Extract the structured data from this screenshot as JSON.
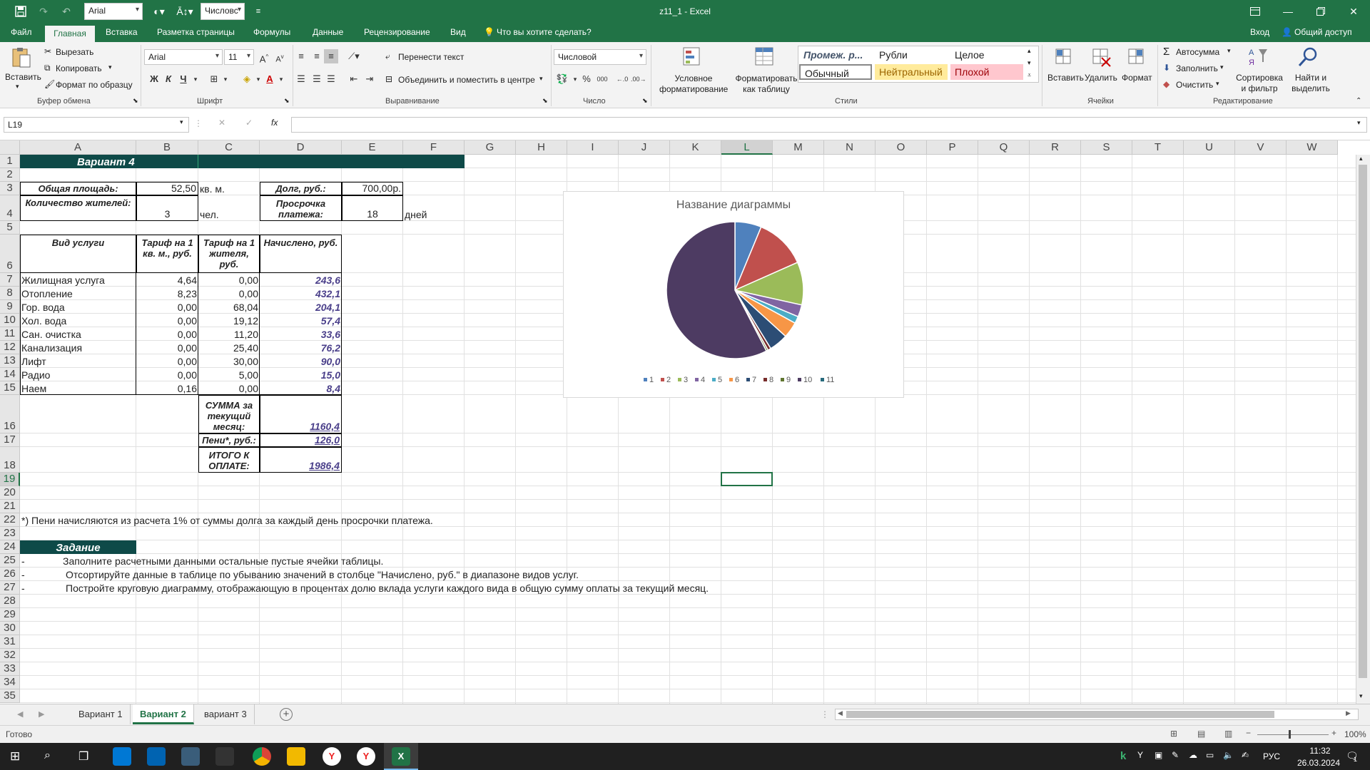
{
  "title_bar": {
    "doc_title": "z11_1 - Excel",
    "font_name": "Arial",
    "number_format": "Числовс"
  },
  "menu": {
    "items": [
      "Файл",
      "Главная",
      "Вставка",
      "Разметка страницы",
      "Формулы",
      "Данные",
      "Рецензирование",
      "Вид"
    ],
    "tell_me": "Что вы хотите сделать?",
    "sign_in": "Вход",
    "share": "Общий доступ"
  },
  "ribbon": {
    "clipboard": {
      "paste": "Вставить",
      "cut": "Вырезать",
      "copy": "Копировать",
      "format_painter": "Формат по образцу",
      "group": "Буфер обмена"
    },
    "font": {
      "name": "Arial",
      "size": "11",
      "bold": "Ж",
      "italic": "К",
      "underline": "Ч",
      "group": "Шрифт"
    },
    "alignment": {
      "wrap": "Перенести текст",
      "merge": "Объединить и поместить в центре",
      "group": "Выравнивание"
    },
    "number": {
      "format": "Числовой",
      "group": "Число"
    },
    "styles": {
      "conditional": "Условное форматирование",
      "format_table": "Форматировать как таблицу",
      "cells": [
        "Промеж. р...",
        "Рубли",
        "Целое",
        "Обычный",
        "Нейтральный",
        "Плохой"
      ],
      "group": "Стили"
    },
    "cells_group": {
      "insert": "Вставить",
      "delete": "Удалить",
      "format": "Формат",
      "group": "Ячейки"
    },
    "editing": {
      "autosum": "Автосумма",
      "fill": "Заполнить",
      "clear": "Очистить",
      "sort": "Сортировка и фильтр",
      "find": "Найти и выделить",
      "group": "Редактирование"
    }
  },
  "formula_bar": {
    "name_box": "L19",
    "fx": "fx"
  },
  "columns": [
    "A",
    "B",
    "C",
    "D",
    "E",
    "F",
    "G",
    "H",
    "I",
    "J",
    "K",
    "L",
    "M",
    "N",
    "O",
    "P",
    "Q",
    "R",
    "S",
    "T",
    "U",
    "V",
    "W"
  ],
  "rows": [
    "1",
    "2",
    "3",
    "4",
    "5",
    "6",
    "7",
    "8",
    "9",
    "10",
    "11",
    "12",
    "13",
    "14",
    "15",
    "16",
    "17",
    "18",
    "19",
    "20",
    "21",
    "22",
    "23",
    "24",
    "25",
    "26",
    "27",
    "28",
    "29",
    "30",
    "31",
    "32",
    "33",
    "34",
    "35"
  ],
  "sheet": {
    "variant_title": "Вариант 4",
    "area_label": "Общая площадь:",
    "area_value": "52,50",
    "area_unit": "кв. м.",
    "residents_label": "Количество жителей:",
    "residents_value": "3",
    "residents_unit": "чел.",
    "debt_label": "Долг, руб.:",
    "debt_value": "700,00р.",
    "overdue_label": "Просрочка платежа:",
    "overdue_value": "18",
    "overdue_unit": "дней",
    "headers": [
      "Вид услуги",
      "Тариф на 1 кв. м., руб.",
      "Тариф на 1 жителя, руб.",
      "Начислено, руб."
    ],
    "services": [
      {
        "name": "Жилищная услуга",
        "t_area": "4,64",
        "t_res": "0,00",
        "charged": "243,6"
      },
      {
        "name": "Отопление",
        "t_area": "8,23",
        "t_res": "0,00",
        "charged": "432,1"
      },
      {
        "name": "Гор. вода",
        "t_area": "0,00",
        "t_res": "68,04",
        "charged": "204,1"
      },
      {
        "name": "Хол. вода",
        "t_area": "0,00",
        "t_res": "19,12",
        "charged": "57,4"
      },
      {
        "name": "Сан. очистка",
        "t_area": "0,00",
        "t_res": "11,20",
        "charged": "33,6"
      },
      {
        "name": "Канализация",
        "t_area": "0,00",
        "t_res": "25,40",
        "charged": "76,2"
      },
      {
        "name": "Лифт",
        "t_area": "0,00",
        "t_res": "30,00",
        "charged": "90,0"
      },
      {
        "name": "Радио",
        "t_area": "0,00",
        "t_res": "5,00",
        "charged": "15,0"
      },
      {
        "name": "Наем",
        "t_area": "0,16",
        "t_res": "0,00",
        "charged": "8,4"
      }
    ],
    "sum_label": "СУММА за текущий месяц:",
    "sum_value": "1160,4",
    "penalty_label": "Пени*, руб.:",
    "penalty_value": "126,0",
    "total_label": "ИТОГО К ОПЛАТЕ:",
    "total_value": "1986,4",
    "footnote": "*) Пени начисляются из расчета 1% от суммы долга за каждый день просрочки платежа.",
    "task_title": "Задание",
    "task_dash": "-",
    "tasks": [
      "Заполните расчетными данными остальные пустые ячейки таблицы.",
      "Отсортируйте данные в таблице по убыванию значений в столбце \"Начислено, руб.\" в диапазоне видов услуг.",
      "Постройте круговую диаграмму, отображающую в процентах долю вклада услуги каждого вида в общую сумму оплаты за текущий месяц."
    ]
  },
  "chart_data": {
    "type": "pie",
    "title": "Название диаграммы",
    "categories": [
      "1",
      "2",
      "3",
      "4",
      "5",
      "6",
      "7",
      "8",
      "9",
      "10",
      "11"
    ],
    "values": [
      126.0,
      243.6,
      204.1,
      57.4,
      33.6,
      76.2,
      90.0,
      15.0,
      8.4,
      1160.4,
      0
    ],
    "colors": [
      "#4f81bd",
      "#c0504d",
      "#9bbb59",
      "#8064a2",
      "#4bacc6",
      "#f79646",
      "#2c4d75",
      "#772c2a",
      "#5f7530",
      "#4d3b62",
      "#276a7c"
    ],
    "legend": "bottom"
  },
  "sheet_tabs": [
    "Вариант 1",
    "Вариант 2",
    "вариант 3"
  ],
  "active_tab": 1,
  "status": {
    "ready": "Готово",
    "zoom": "100%"
  },
  "taskbar": {
    "lang": "РУС",
    "time": "11:32",
    "date": "26.03.2024",
    "notif": "1"
  }
}
